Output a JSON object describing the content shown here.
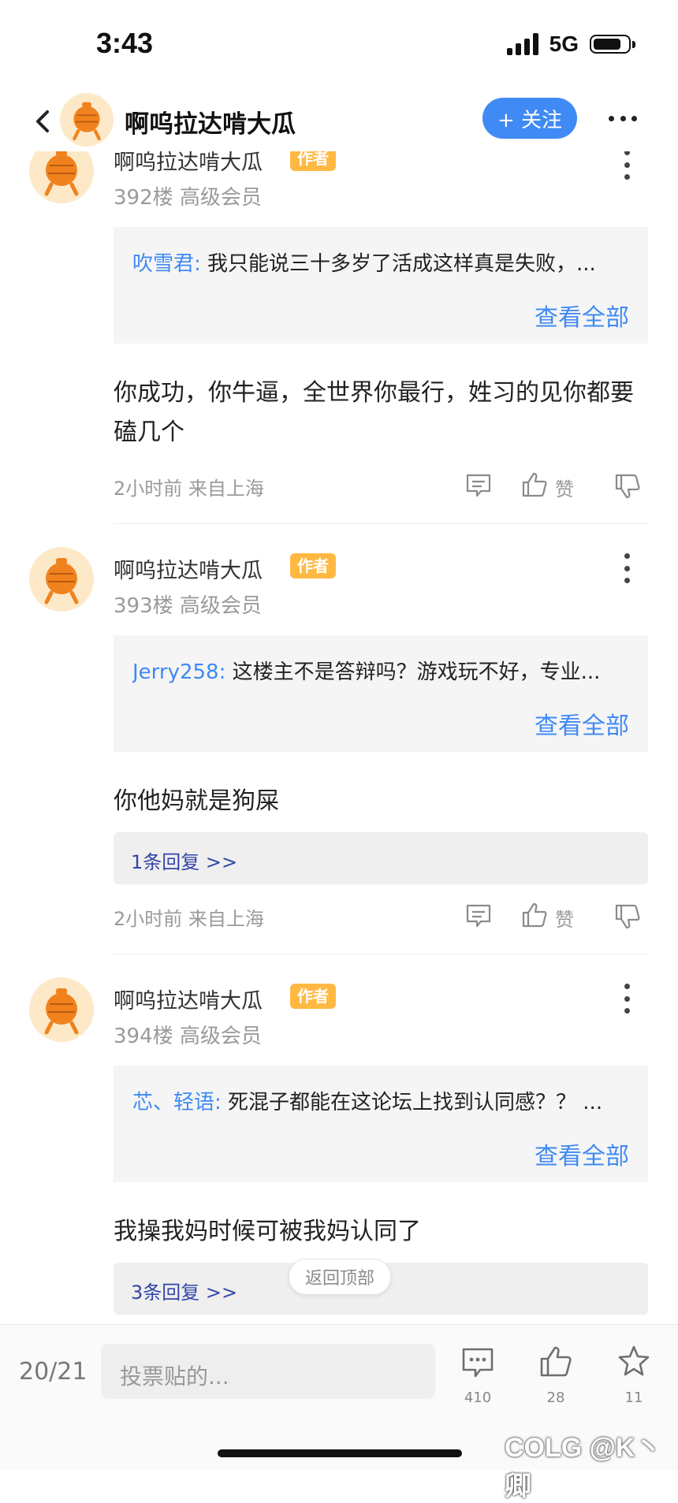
{
  "status": {
    "time": "3:43",
    "network": "5G"
  },
  "header": {
    "title": "啊呜拉达啃大瓜",
    "follow_label": "+ 关注"
  },
  "posts": [
    {
      "username": "啊呜拉达啃大瓜",
      "badge": "作者",
      "floor": "392楼 高级会员",
      "quote_user": "吹雪君:",
      "quote_text": " 我只能说三十多岁了活成这样真是失败，...",
      "quote_more": "查看全部",
      "content": "你成功，你牛逼，全世界你最行，姓习的见你都要磕几个",
      "replies": "",
      "meta": "2小时前 来自上海",
      "like_label": "赞"
    },
    {
      "username": "啊呜拉达啃大瓜",
      "badge": "作者",
      "floor": "393楼 高级会员",
      "quote_user": "Jerry258:",
      "quote_text": " 这楼主不是答辩吗？游戏玩不好，专业...",
      "quote_more": "查看全部",
      "content": "你他妈就是狗屎",
      "replies": "1条回复 >>",
      "meta": "2小时前 来自上海",
      "like_label": "赞"
    },
    {
      "username": "啊呜拉达啃大瓜",
      "badge": "作者",
      "floor": "394楼 高级会员",
      "quote_user": "芯、轻语:",
      "quote_text": " 死混子都能在这论坛上找到认同感？？ ...",
      "quote_more": "查看全部",
      "content": "我操我妈时候可被我妈认同了",
      "replies": "3条回复 >>",
      "meta": "",
      "like_label": ""
    }
  ],
  "back_to_top": "返回顶部",
  "bottom_bar": {
    "page_indicator": "20/21",
    "input_placeholder": "投票贴的...",
    "comment_count": "410",
    "like_count": "28",
    "fav_count": "11"
  },
  "watermark": "COLG @K丶卿",
  "colors": {
    "accent": "#3f8af5",
    "badge": "#ffb943",
    "reply_link": "#3245a8"
  }
}
